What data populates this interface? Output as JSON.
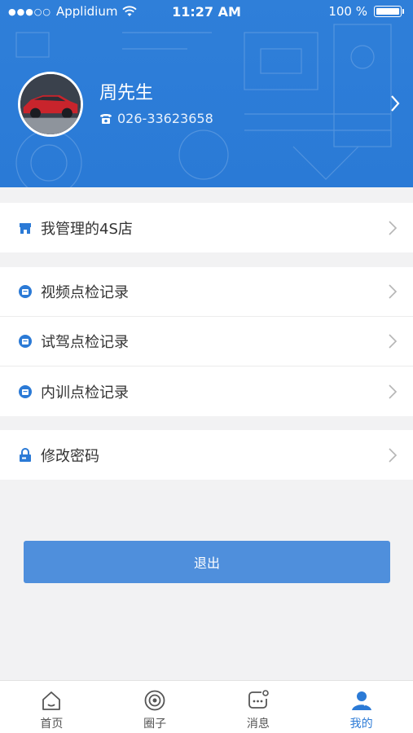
{
  "status_bar": {
    "signal": "●●●○○",
    "carrier": "Applidium",
    "time": "11:27 AM",
    "battery_text": "100 %"
  },
  "profile": {
    "name": "周先生",
    "phone": "026-33623658"
  },
  "menu": {
    "store": {
      "label": "我管理的4S店"
    },
    "video_check": {
      "label": "视频点检记录"
    },
    "test_drive_check": {
      "label": "试驾点检记录"
    },
    "training_check": {
      "label": "内训点检记录"
    },
    "change_password": {
      "label": "修改密码"
    }
  },
  "logout_label": "退出",
  "tabs": [
    {
      "label": "首页",
      "icon": "home-icon",
      "active": false
    },
    {
      "label": "圈子",
      "icon": "circle-icon",
      "active": false
    },
    {
      "label": "消息",
      "icon": "message-icon",
      "active": false
    },
    {
      "label": "我的",
      "icon": "user-icon",
      "active": true
    }
  ],
  "colors": {
    "accent": "#2b7ad6",
    "header": "#2f7fd9",
    "button": "#4f8fdc",
    "background": "#f2f2f3"
  }
}
